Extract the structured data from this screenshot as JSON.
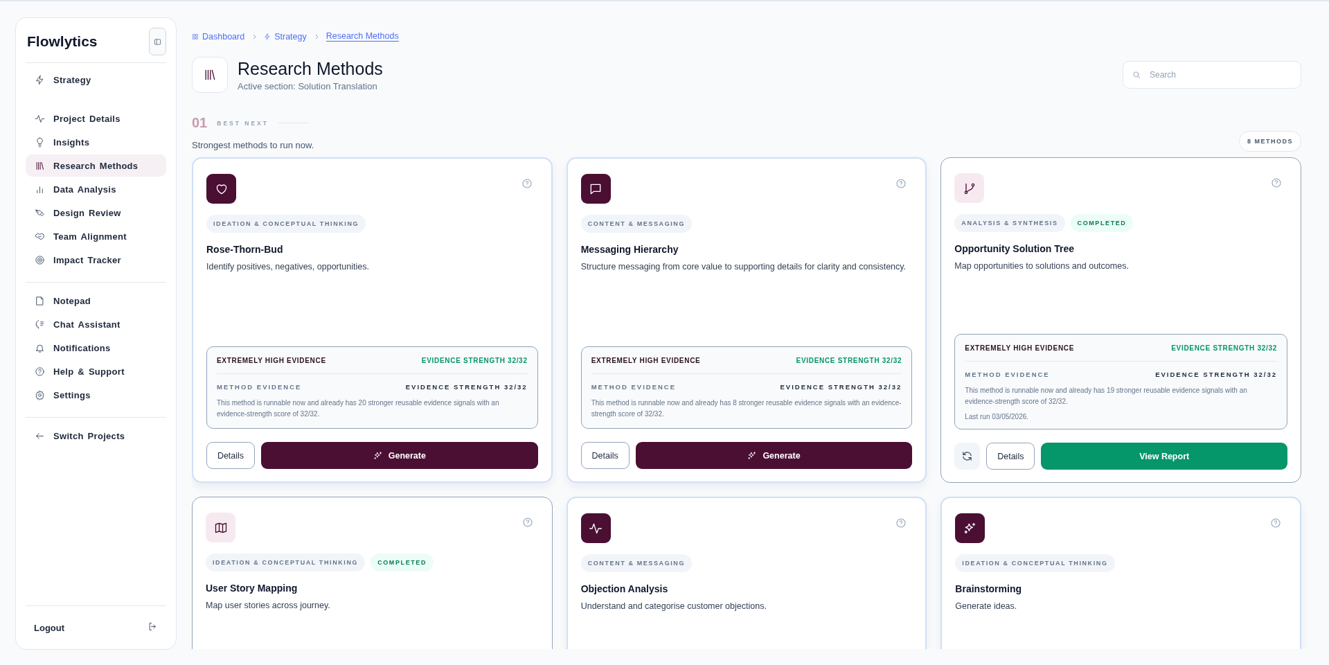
{
  "sidebar": {
    "brand": "Flowlytics",
    "groups": [
      {
        "blocks": [
          {
            "items": [
              {
                "label": "Strategy",
                "selected": false
              }
            ]
          },
          {
            "items": [
              {
                "label": "Project Details",
                "selected": false
              },
              {
                "label": "Insights",
                "selected": false
              },
              {
                "label": "Research Methods",
                "selected": true
              },
              {
                "label": "Data Analysis",
                "selected": false
              },
              {
                "label": "Design Review",
                "selected": false
              },
              {
                "label": "Team Alignment",
                "selected": false
              },
              {
                "label": "Impact Tracker",
                "selected": false
              }
            ]
          }
        ]
      },
      {
        "blocks": [
          {
            "items": [
              {
                "label": "Notepad",
                "selected": false
              },
              {
                "label": "Chat Assistant",
                "selected": false
              },
              {
                "label": "Notifications",
                "selected": false
              },
              {
                "label": "Help & Support",
                "selected": false
              },
              {
                "label": "Settings",
                "selected": false
              }
            ]
          }
        ]
      },
      {
        "blocks": [
          {
            "items": [
              {
                "label": "Switch Projects",
                "selected": false
              }
            ]
          }
        ]
      }
    ],
    "logout": "Logout"
  },
  "breadcrumb": [
    {
      "label": "Dashboard",
      "selected": false
    },
    {
      "label": "Strategy",
      "selected": false
    },
    {
      "label": "Research Methods",
      "selected": true
    }
  ],
  "header": {
    "title": "Research Methods",
    "subtitle": "Active section: Solution Translation"
  },
  "search": {
    "placeholder": "Search"
  },
  "section": {
    "number": "01",
    "label": "BEST NEXT",
    "subtitle": "Strongest methods to run now.",
    "count": "8 METHODS"
  },
  "cards": [
    {
      "category": "IDEATION & CONCEPTUAL THINKING",
      "completed": false,
      "title": "Rose-Thorn-Bud",
      "description": "Identify positives, negatives, opportunities.",
      "evidence": {
        "level_label": "EXTREMELY HIGH EVIDENCE",
        "level_strength": "EVIDENCE STRENGTH 32/32",
        "method_label": "METHOD EVIDENCE",
        "method_strength": "EVIDENCE STRENGTH 32/32",
        "note": "This method is runnable now and already has 20 stronger reusable evidence signals with an evidence-strength score of 32/32."
      },
      "actions": [
        {
          "kind": "details",
          "label": "Details"
        },
        {
          "kind": "generate",
          "label": "Generate"
        }
      ]
    },
    {
      "category": "CONTENT & MESSAGING",
      "completed": false,
      "title": "Messaging Hierarchy",
      "description": "Structure messaging from core value to supporting details for clarity and consistency.",
      "evidence": {
        "level_label": "EXTREMELY HIGH EVIDENCE",
        "level_strength": "EVIDENCE STRENGTH 32/32",
        "method_label": "METHOD EVIDENCE",
        "method_strength": "EVIDENCE STRENGTH 32/32",
        "note": "This method is runnable now and already has 8 stronger reusable evidence signals with an evidence-strength score of 32/32."
      },
      "actions": [
        {
          "kind": "details",
          "label": "Details"
        },
        {
          "kind": "generate",
          "label": "Generate"
        }
      ]
    },
    {
      "category": "ANALYSIS & SYNTHESIS",
      "completed": true,
      "status": "COMPLETED",
      "title": "Opportunity Solution Tree",
      "description": "Map opportunities to solutions and outcomes.",
      "evidence": {
        "level_label": "EXTREMELY HIGH EVIDENCE",
        "level_strength": "EVIDENCE STRENGTH 32/32",
        "method_label": "METHOD EVIDENCE",
        "method_strength": "EVIDENCE STRENGTH 32/32",
        "note": "This method is runnable now and already has 19 stronger reusable evidence signals with an evidence-strength score of 32/32.",
        "last_run": "Last run 03/05/2026."
      },
      "actions": [
        {
          "kind": "refresh"
        },
        {
          "kind": "details",
          "label": "Details"
        },
        {
          "kind": "report",
          "label": "View Report"
        }
      ]
    },
    {
      "category": "IDEATION & CONCEPTUAL THINKING",
      "completed": true,
      "status": "COMPLETED",
      "title": "User Story Mapping",
      "description": "Map user stories across journey."
    },
    {
      "category": "CONTENT & MESSAGING",
      "completed": false,
      "title": "Objection Analysis",
      "description": "Understand and categorise customer objections."
    },
    {
      "category": "IDEATION & CONCEPTUAL THINKING",
      "completed": false,
      "title": "Brainstorming",
      "description": "Generate ideas."
    }
  ]
}
